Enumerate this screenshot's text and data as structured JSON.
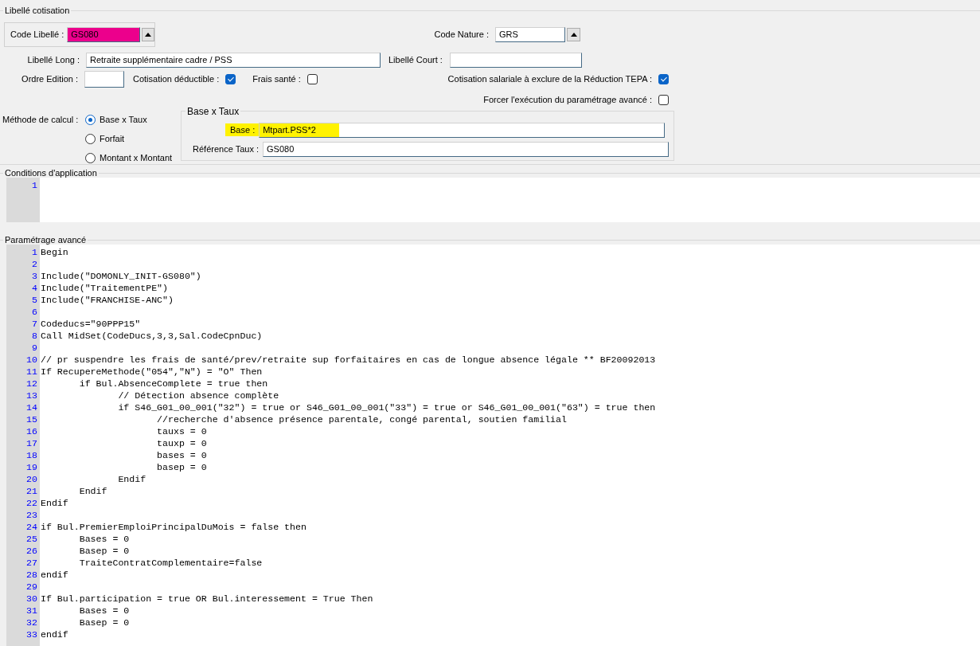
{
  "main_group": {
    "title": "Libellé cotisation"
  },
  "code_libelle": {
    "label": "Code Libellé :",
    "value": "GS080",
    "color": "#ec008c"
  },
  "code_nature": {
    "label": "Code Nature :",
    "value": "GRS"
  },
  "libelle_long": {
    "label": "Libellé Long :",
    "value": "Retraite supplémentaire cadre / PSS"
  },
  "libelle_court": {
    "label": "Libellé Court :"
  },
  "ordre_edition": {
    "label": "Ordre Edition :"
  },
  "checkboxes": [
    {
      "label": "Cotisation déductible :",
      "checked": true
    },
    {
      "label": "Frais santé :",
      "checked": false
    },
    {
      "label": "Cotisation salariale à exclure de la Réduction TEPA :",
      "checked": true
    },
    {
      "label": "Forcer l'exécution du paramétrage avancé :",
      "checked": false
    }
  ],
  "methode": {
    "label": "Méthode de calcul :",
    "options": [
      {
        "label": "Base x Taux",
        "selected": true
      },
      {
        "label": "Forfait",
        "selected": false
      },
      {
        "label": "Montant x Montant",
        "selected": false
      }
    ]
  },
  "base_taux": {
    "title": "Base x Taux",
    "fields": [
      {
        "label": "Base :",
        "value": "Mtpart.PSS*2",
        "color": "#fff200"
      },
      {
        "label": "Référence Taux :",
        "value": "GS080"
      }
    ]
  },
  "conditions": {
    "title": "Conditions d'application",
    "lines": [
      {
        "number": "1"
      }
    ]
  },
  "parametrage": {
    "title": "Paramétrage avancé",
    "lines": [
      {
        "number": "1",
        "code": "Begin"
      },
      {
        "number": "2"
      },
      {
        "number": "3",
        "code": "Include(\"DOMONLY_INIT-GS080\")"
      },
      {
        "number": "4",
        "code": "Include(\"TraitementPE\")"
      },
      {
        "number": "5",
        "code": "Include(\"FRANCHISE-ANC\")"
      },
      {
        "number": "6"
      },
      {
        "number": "7",
        "code": "Codeducs=\"90PPP15\""
      },
      {
        "number": "8",
        "code": "Call MidSet(CodeDucs,3,3,Sal.CodeCpnDuc)"
      },
      {
        "number": "9"
      },
      {
        "number": "10",
        "code": "// pr suspendre les frais de santé/prev/retraite sup forfaitaires en cas de longue absence légale ** BF20092013"
      },
      {
        "number": "11",
        "code": "If RecupereMethode(\"054\",\"N\") = \"O\" Then"
      },
      {
        "number": "12",
        "code": "\tif Bul.AbsenceComplete = true then"
      },
      {
        "number": "13",
        "code": "\t\t// Détection absence complète"
      },
      {
        "number": "14",
        "code": "\t\tif S46_G01_00_001(\"32\") = true or S46_G01_00_001(\"33\") = true or S46_G01_00_001(\"63\") = true then"
      },
      {
        "number": "15",
        "code": "\t\t\t//recherche d'absence présence parentale, congé parental, soutien familial"
      },
      {
        "number": "16",
        "code": "\t\t\ttauxs = 0"
      },
      {
        "number": "17",
        "code": "\t\t\ttauxp = 0"
      },
      {
        "number": "18",
        "code": "\t\t\tbases = 0"
      },
      {
        "number": "19",
        "code": "\t\t\tbasep = 0"
      },
      {
        "number": "20",
        "code": "\t\tEndif"
      },
      {
        "number": "21",
        "code": "\tEndif"
      },
      {
        "number": "22",
        "code": "Endif"
      },
      {
        "number": "23"
      },
      {
        "number": "24",
        "code": "if Bul.PremierEmploiPrincipalDuMois = false then"
      },
      {
        "number": "25",
        "code": "\tBases = 0"
      },
      {
        "number": "26",
        "code": "\tBasep = 0"
      },
      {
        "number": "27",
        "code": "\tTraiteContratComplementaire=false"
      },
      {
        "number": "28",
        "code": "endif"
      },
      {
        "number": "29"
      },
      {
        "number": "30",
        "code": "If Bul.participation = true OR Bul.interessement = True Then"
      },
      {
        "number": "31",
        "code": "\tBases = 0"
      },
      {
        "number": "32",
        "code": "\tBasep = 0"
      },
      {
        "number": "33",
        "code": "endif"
      }
    ]
  }
}
